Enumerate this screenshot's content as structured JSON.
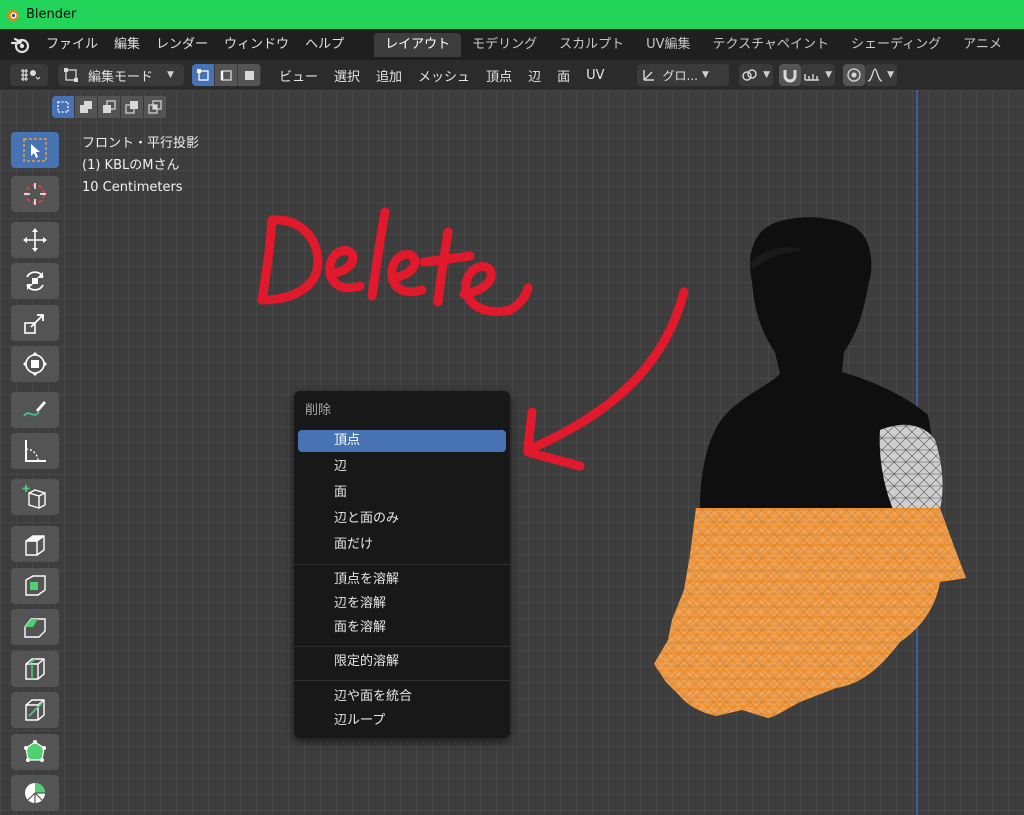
{
  "window": {
    "title": "Blender"
  },
  "menubar": {
    "items": [
      "ファイル",
      "編集",
      "レンダー",
      "ウィンドウ",
      "ヘルプ"
    ],
    "workspaces": [
      "レイアウト",
      "モデリング",
      "スカルプト",
      "UV編集",
      "テクスチャペイント",
      "シェーディング",
      "アニメ"
    ],
    "active_workspace": "レイアウト"
  },
  "header": {
    "mode": "編集モード",
    "menus": [
      "ビュー",
      "選択",
      "追加",
      "メッシュ",
      "頂点",
      "辺",
      "面",
      "UV"
    ],
    "orientation": "グロ..."
  },
  "viewport": {
    "view_name": "フロント・平行投影",
    "object_info": "(1) KBLのMさん",
    "scale": "10 Centimeters"
  },
  "context_menu": {
    "title": "削除",
    "items": [
      "頂点",
      "辺",
      "面",
      "辺と面のみ",
      "面だけ",
      "頂点を溶解",
      "辺を溶解",
      "面を溶解",
      "限定的溶解",
      "辺や面を統合",
      "辺ループ"
    ],
    "highlighted": "頂点"
  },
  "annotation": {
    "text": "Delete",
    "color": "#e0192c"
  },
  "colors": {
    "titlebar": "#22d45a",
    "accent": "#4772b3",
    "selected_mesh": "#f5891e"
  },
  "icons": [
    "blender-logo-icon",
    "select-box-icon",
    "cursor-icon",
    "move-icon",
    "rotate-icon",
    "scale-icon",
    "transform-icon",
    "annotate-icon",
    "measure-icon",
    "add-cube-icon",
    "extrude-icon",
    "inset-icon",
    "bevel-icon",
    "loop-cut-icon",
    "knife-icon",
    "poly-build-icon",
    "spin-icon"
  ]
}
